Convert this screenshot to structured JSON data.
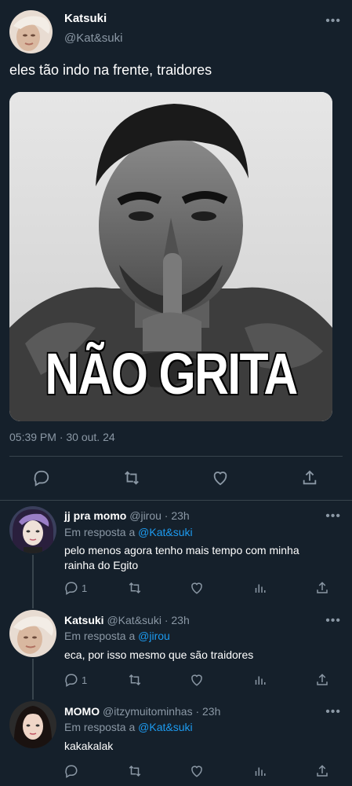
{
  "main_tweet": {
    "name": "Katsuki",
    "handle": "@Kat&suki",
    "text": "eles tão indo na frente, traidores",
    "image_caption": "NÃO GRITA",
    "meta": "05:39 PM · 30 out. 24",
    "more": "•••"
  },
  "replies": [
    {
      "name": "jj pra momo",
      "handle_time": "@jirou · 23h",
      "in_reply_prefix": "Em resposta a",
      "in_reply_to": "@Kat&suki",
      "text_line1": "pelo menos agora tenho mais tempo com minha",
      "text_line2": "rainha do Egito",
      "reply_count": "1",
      "more": "•••"
    },
    {
      "name": "Katsuki",
      "handle_time": "@Kat&suki · 23h",
      "in_reply_prefix": "Em resposta a",
      "in_reply_to": "@jirou",
      "text_line1": "eca, por isso mesmo que são traidores",
      "reply_count": "1",
      "more": "•••"
    },
    {
      "name": "MOMO",
      "handle_time": "@itzymuitominhas · 23h",
      "in_reply_prefix": "Em resposta a",
      "in_reply_to": "@Kat&suki",
      "text_line1": "kakakalak",
      "reply_count": "",
      "more": "•••"
    }
  ],
  "colors": {
    "background": "#15202b",
    "secondary_text": "#8b98a5",
    "link": "#1d9bf0",
    "divider": "#38444d"
  },
  "icons": [
    "reply-icon",
    "retweet-icon",
    "like-icon",
    "views-icon",
    "share-icon",
    "more-icon"
  ]
}
